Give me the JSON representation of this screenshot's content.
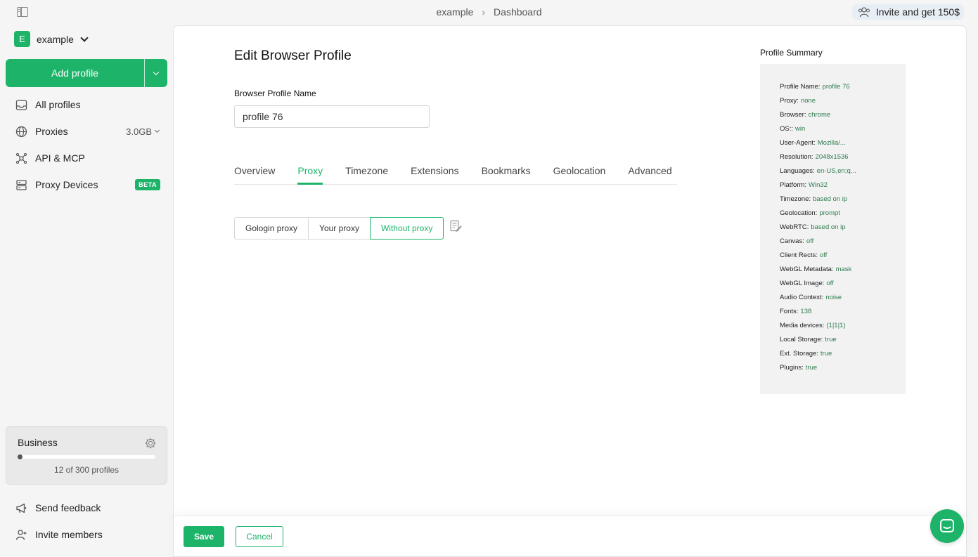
{
  "topbar": {
    "breadcrumb": [
      "example",
      "Dashboard"
    ],
    "invite_label": "Invite and get 150$"
  },
  "sidebar": {
    "workspace": {
      "initial": "E",
      "name": "example"
    },
    "add_profile_label": "Add profile",
    "items": [
      {
        "label": "All profiles",
        "icon": "inbox-icon"
      },
      {
        "label": "Proxies",
        "icon": "globe-icon",
        "meta": "3.0GB"
      },
      {
        "label": "API & MCP",
        "icon": "api-icon"
      },
      {
        "label": "Proxy Devices",
        "icon": "server-icon",
        "badge": "BETA"
      }
    ],
    "plan": {
      "name": "Business",
      "count_label": "12 of 300 profiles",
      "used": 12,
      "total": 300
    },
    "bottom_items": [
      {
        "label": "Send feedback",
        "icon": "megaphone-icon"
      },
      {
        "label": "Invite members",
        "icon": "user-plus-icon"
      }
    ]
  },
  "main": {
    "title": "Edit Browser Profile",
    "name_label": "Browser Profile Name",
    "name_value": "profile 76",
    "tabs": [
      "Overview",
      "Proxy",
      "Timezone",
      "Extensions",
      "Bookmarks",
      "Geolocation",
      "Advanced"
    ],
    "active_tab": "Proxy",
    "proxy_options": [
      "Gologin proxy",
      "Your proxy",
      "Without proxy"
    ],
    "active_proxy_option": "Without proxy"
  },
  "summary": {
    "title": "Profile Summary",
    "rows": [
      {
        "key": "Profile Name:",
        "value": "profile 76"
      },
      {
        "key": "Proxy:",
        "value": "none"
      },
      {
        "key": "Browser:",
        "value": "chrome"
      },
      {
        "key": "OS::",
        "value": "win"
      },
      {
        "key": "User-Agent:",
        "value": "Mozilla/..."
      },
      {
        "key": "Resolution:",
        "value": "2048x1536"
      },
      {
        "key": "Languages:",
        "value": "en-US,en;q..."
      },
      {
        "key": "Platform:",
        "value": "Win32"
      },
      {
        "key": "Timezone:",
        "value": "based on ip"
      },
      {
        "key": "Geolocation:",
        "value": "prompt"
      },
      {
        "key": "WebRTC:",
        "value": "based on ip"
      },
      {
        "key": "Canvas:",
        "value": "off"
      },
      {
        "key": "Client Rects:",
        "value": "off"
      },
      {
        "key": "WebGL Metadata:",
        "value": "mask"
      },
      {
        "key": "WebGL Image:",
        "value": "off"
      },
      {
        "key": "Audio Context:",
        "value": "noise"
      },
      {
        "key": "Fonts:",
        "value": "138"
      },
      {
        "key": "Media devices:",
        "value": "(1|1|1)"
      },
      {
        "key": "Local Storage:",
        "value": "true"
      },
      {
        "key": "Ext. Storage:",
        "value": "true"
      },
      {
        "key": "Plugins:",
        "value": "true"
      }
    ]
  },
  "footer": {
    "save_label": "Save",
    "cancel_label": "Cancel"
  },
  "colors": {
    "accent": "#1db46a",
    "summary_value": "#2e7d4f"
  }
}
